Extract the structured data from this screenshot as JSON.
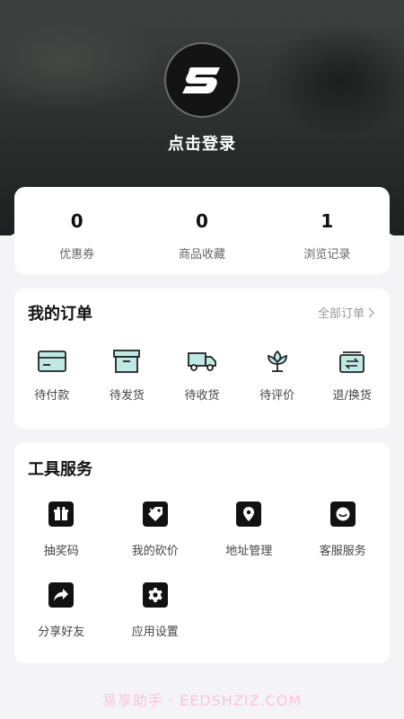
{
  "header": {
    "login_text": "点击登录",
    "avatar_icon": "brand-s-logo-icon"
  },
  "stats": [
    {
      "value": "0",
      "label": "优惠券"
    },
    {
      "value": "0",
      "label": "商品收藏"
    },
    {
      "value": "1",
      "label": "浏览记录"
    }
  ],
  "orders": {
    "title": "我的订单",
    "all_link": "全部订单",
    "items": [
      {
        "label": "待付款",
        "icon": "card-icon"
      },
      {
        "label": "待发货",
        "icon": "box-icon"
      },
      {
        "label": "待收货",
        "icon": "truck-icon"
      },
      {
        "label": "待评价",
        "icon": "flower-icon"
      },
      {
        "label": "退/换货",
        "icon": "exchange-icon"
      }
    ]
  },
  "tools": {
    "title": "工具服务",
    "items": [
      {
        "label": "抽奖码",
        "icon": "gift-icon"
      },
      {
        "label": "我的砍价",
        "icon": "tag-icon"
      },
      {
        "label": "地址管理",
        "icon": "location-pin-icon"
      },
      {
        "label": "客服服务",
        "icon": "chat-icon"
      },
      {
        "label": "分享好友",
        "icon": "share-icon"
      },
      {
        "label": "应用设置",
        "icon": "gear-icon"
      }
    ]
  },
  "watermark": "易享助手 · EEDSHZIZ.COM",
  "colors": {
    "accent_teal": "#bfe9e4",
    "icon_dark": "#111111",
    "background": "#f4f4f6"
  }
}
